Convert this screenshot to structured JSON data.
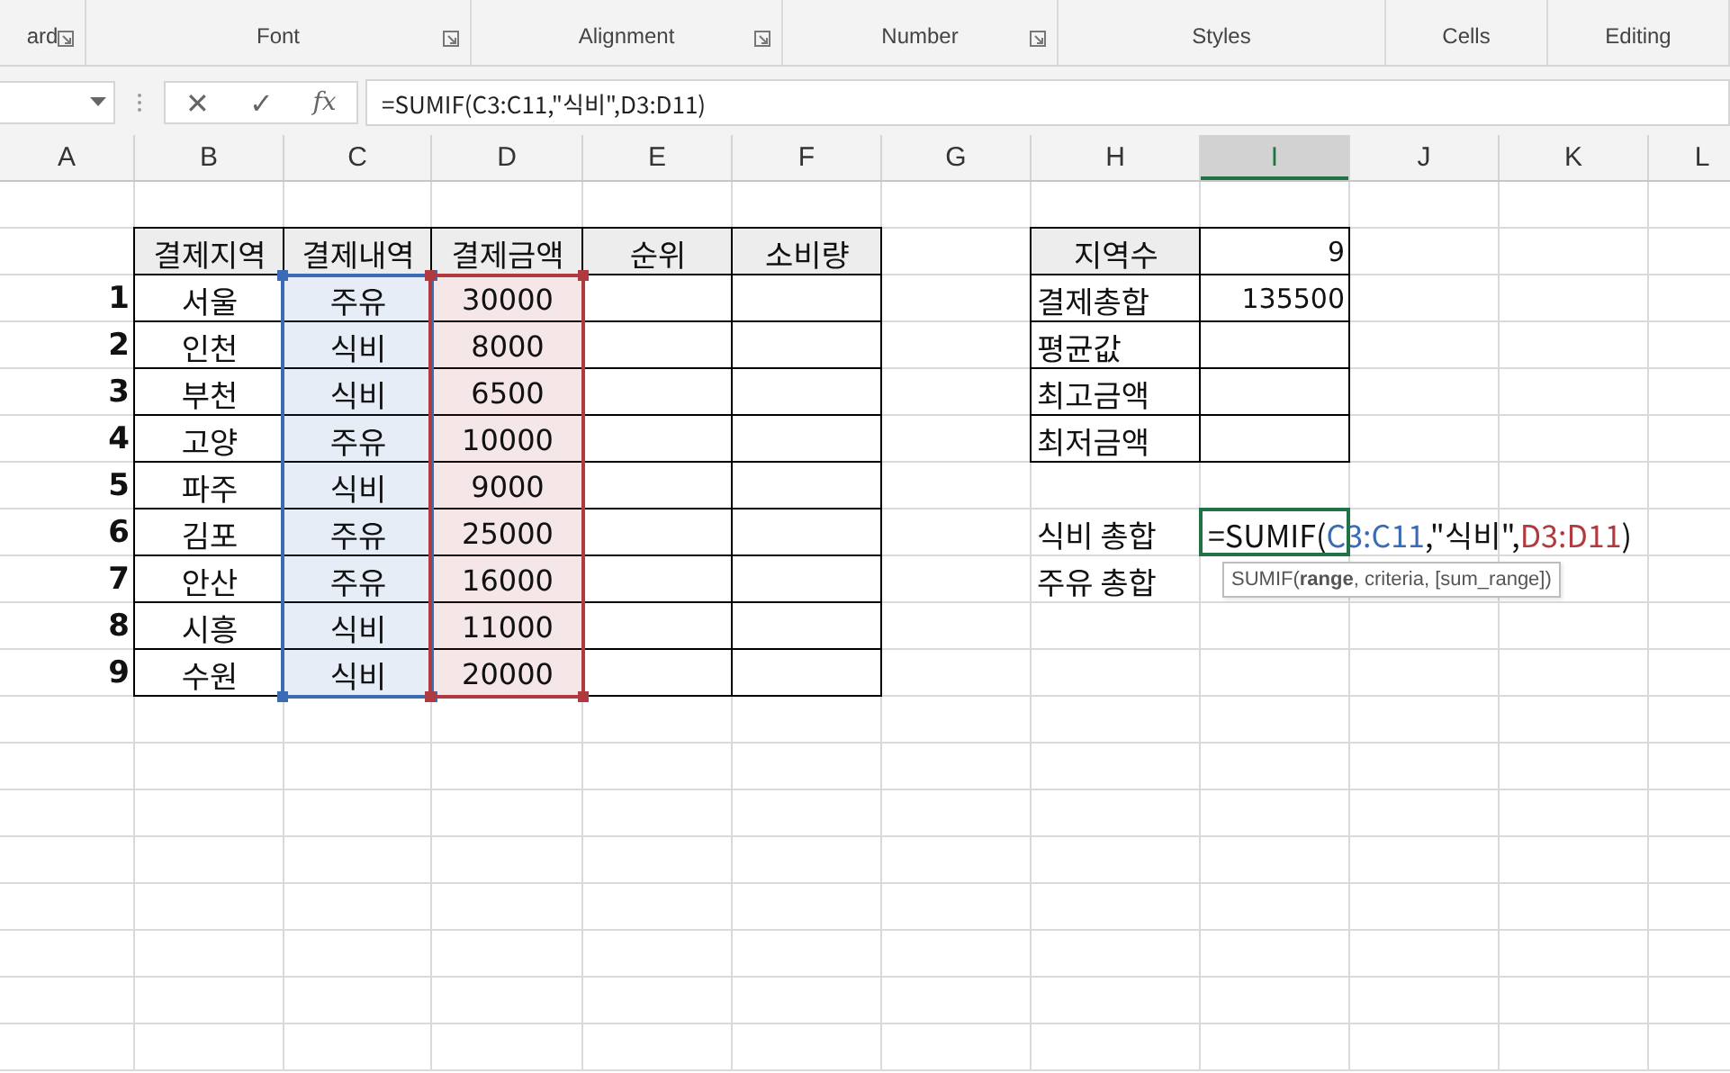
{
  "ribbon": {
    "groups": [
      {
        "label": "ard",
        "launcher": true
      },
      {
        "label": "Font",
        "launcher": true
      },
      {
        "label": "Alignment",
        "launcher": true
      },
      {
        "label": "Number",
        "launcher": true
      },
      {
        "label": "Styles",
        "launcher": false
      },
      {
        "label": "Cells",
        "launcher": false
      },
      {
        "label": "Editing",
        "launcher": false
      }
    ]
  },
  "formula_bar": {
    "cancel": "✕",
    "enter": "✓",
    "function": "fx",
    "formula": "=SUMIF(C3:C11,\"식비\",D3:D11)"
  },
  "columns": [
    {
      "label": "A",
      "selected": false
    },
    {
      "label": "B",
      "selected": false
    },
    {
      "label": "C",
      "selected": false
    },
    {
      "label": "D",
      "selected": false
    },
    {
      "label": "E",
      "selected": false
    },
    {
      "label": "F",
      "selected": false
    },
    {
      "label": "G",
      "selected": false
    },
    {
      "label": "H",
      "selected": false
    },
    {
      "label": "I",
      "selected": true
    },
    {
      "label": "J",
      "selected": false
    },
    {
      "label": "K",
      "selected": false
    },
    {
      "label": "L",
      "selected": false
    }
  ],
  "table": {
    "headers": [
      "결제지역",
      "결제내역",
      "결제금액",
      "순위",
      "소비량"
    ],
    "rows": [
      {
        "number": "1",
        "region": "서울",
        "item": "주유",
        "amount": "30000"
      },
      {
        "number": "2",
        "region": "인천",
        "item": "식비",
        "amount": "8000"
      },
      {
        "number": "3",
        "region": "부천",
        "item": "식비",
        "amount": "6500"
      },
      {
        "number": "4",
        "region": "고양",
        "item": "주유",
        "amount": "10000"
      },
      {
        "number": "5",
        "region": "파주",
        "item": "식비",
        "amount": "9000"
      },
      {
        "number": "6",
        "region": "김포",
        "item": "주유",
        "amount": "25000"
      },
      {
        "number": "7",
        "region": "안산",
        "item": "주유",
        "amount": "16000"
      },
      {
        "number": "8",
        "region": "시흥",
        "item": "식비",
        "amount": "11000"
      },
      {
        "number": "9",
        "region": "수원",
        "item": "식비",
        "amount": "20000"
      }
    ]
  },
  "summary": [
    {
      "label": "지역수",
      "value": "9",
      "kind": "header"
    },
    {
      "label": "결제총합",
      "value": "135500",
      "kind": "plain"
    },
    {
      "label": "평균값",
      "kind": "plain"
    },
    {
      "label": "최고금액",
      "kind": "plain"
    },
    {
      "label": "최저금액",
      "kind": "plain"
    }
  ],
  "totals": [
    {
      "label": "식비 총합",
      "editing": true,
      "formula_parts": [
        {
          "text": "=SUMIF(",
          "kind": "plain"
        },
        {
          "text": "C3:C11",
          "kind": "ref",
          "color": "#3c6bb5"
        },
        {
          "text": ",\"식비\",",
          "kind": "plain"
        },
        {
          "text": "D3:D11",
          "kind": "ref",
          "color": "#b03a3f"
        },
        {
          "text": ")",
          "kind": "plain"
        }
      ],
      "tooltip": "SUMIF(**range**, criteria, [sum_range])"
    },
    {
      "label": "주유 총합",
      "editing": false
    }
  ]
}
